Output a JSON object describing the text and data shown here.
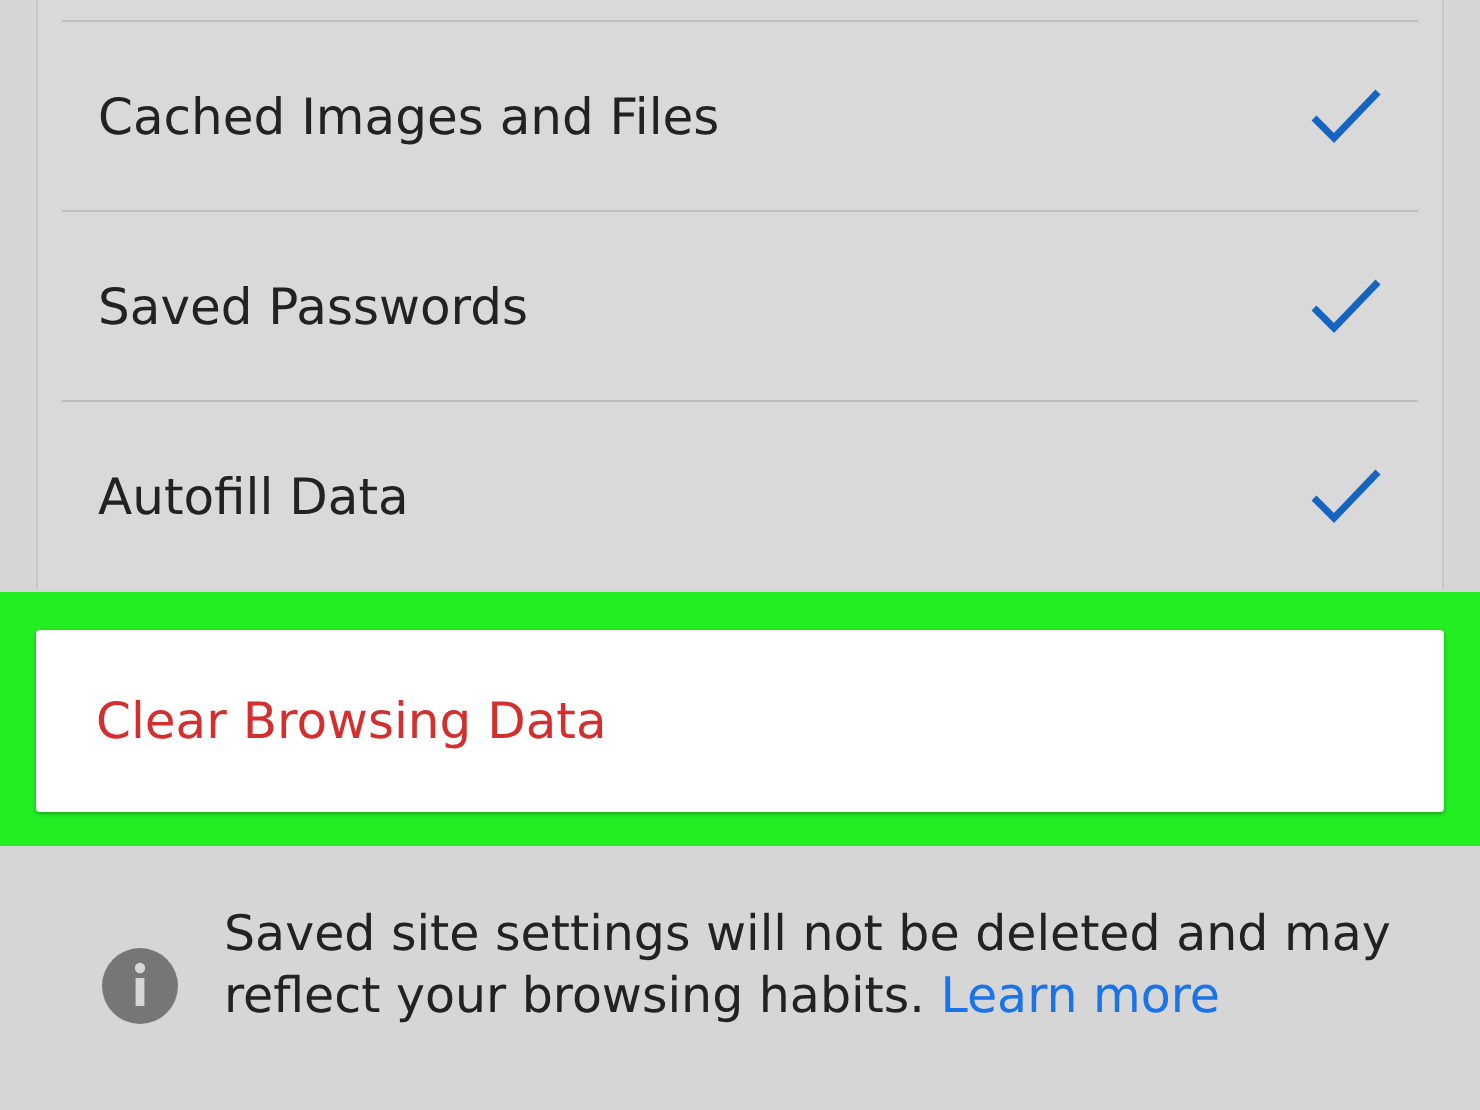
{
  "options": [
    {
      "label": "Cached Images and Files",
      "checked": true
    },
    {
      "label": "Saved Passwords",
      "checked": true
    },
    {
      "label": "Autofill Data",
      "checked": true
    }
  ],
  "action": {
    "label": "Clear Browsing Data",
    "highlighted": true
  },
  "note": {
    "text": "Saved site settings will not be deleted and may reflect your browsing habits.",
    "link": "Learn more"
  }
}
